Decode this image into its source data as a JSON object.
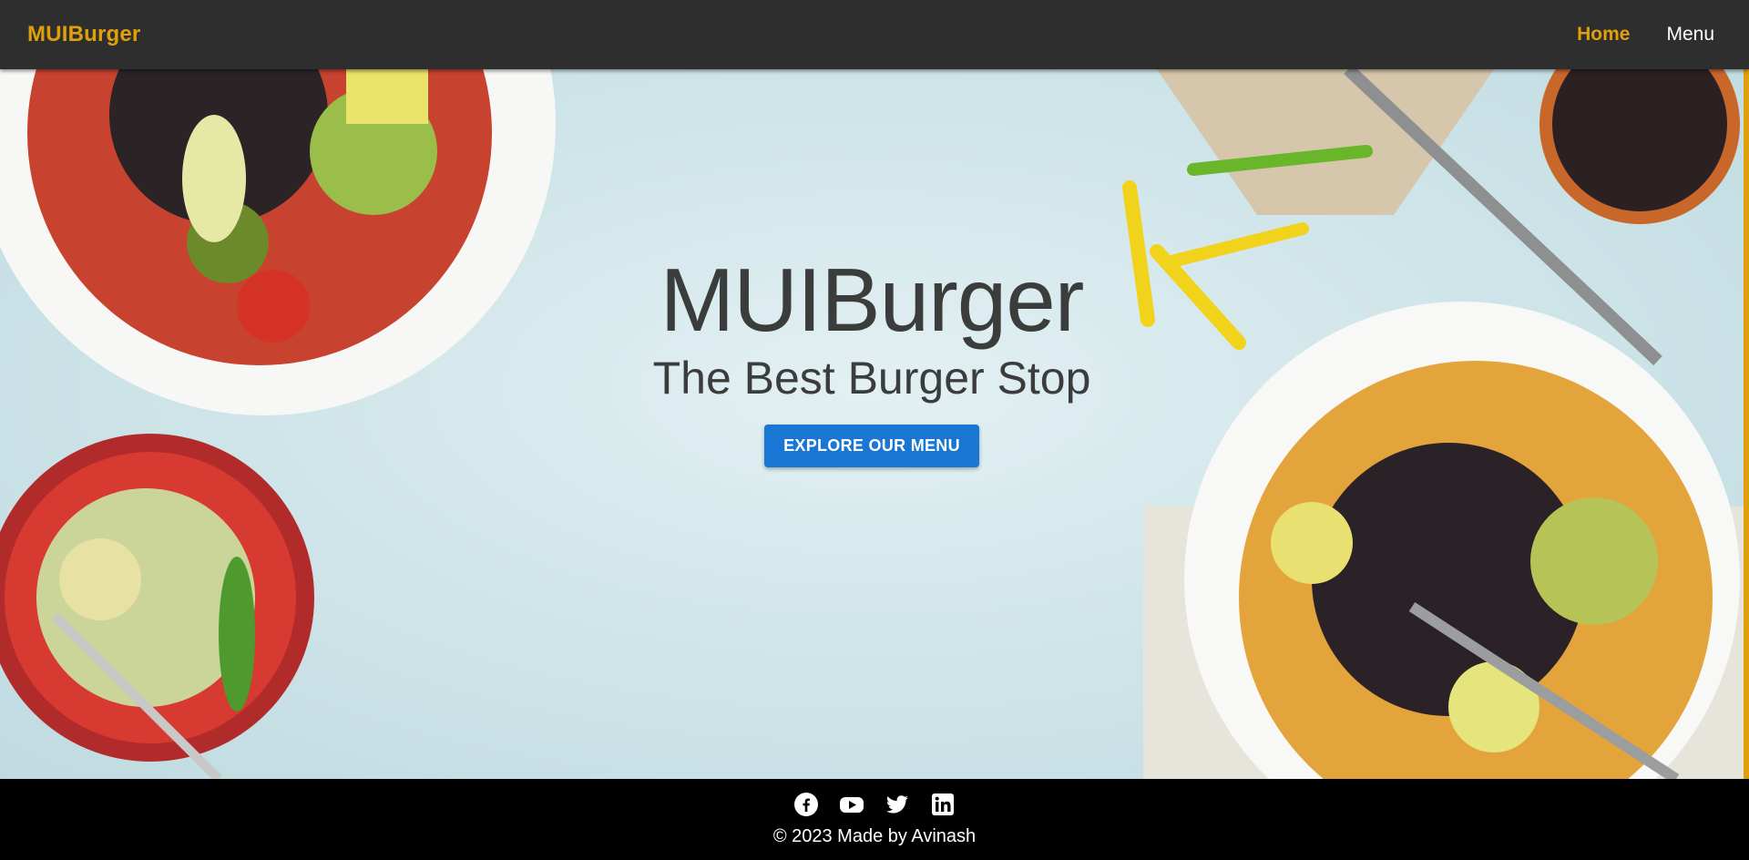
{
  "navbar": {
    "brand": "MUIBurger",
    "links": [
      {
        "label": "Home",
        "active": true
      },
      {
        "label": "Menu",
        "active": false
      }
    ],
    "accent_color": "#e0a00c",
    "background_color": "#2e2e2e"
  },
  "hero": {
    "title": "MUIBurger",
    "subtitle": "The Best Burger Stop",
    "cta_label": "EXPLORE OUR MENU",
    "cta_color": "#1976d2"
  },
  "footer": {
    "social_icons": [
      "facebook-icon",
      "youtube-icon",
      "twitter-icon",
      "linkedin-icon"
    ],
    "copyright": "© 2023 Made by Avinash"
  }
}
